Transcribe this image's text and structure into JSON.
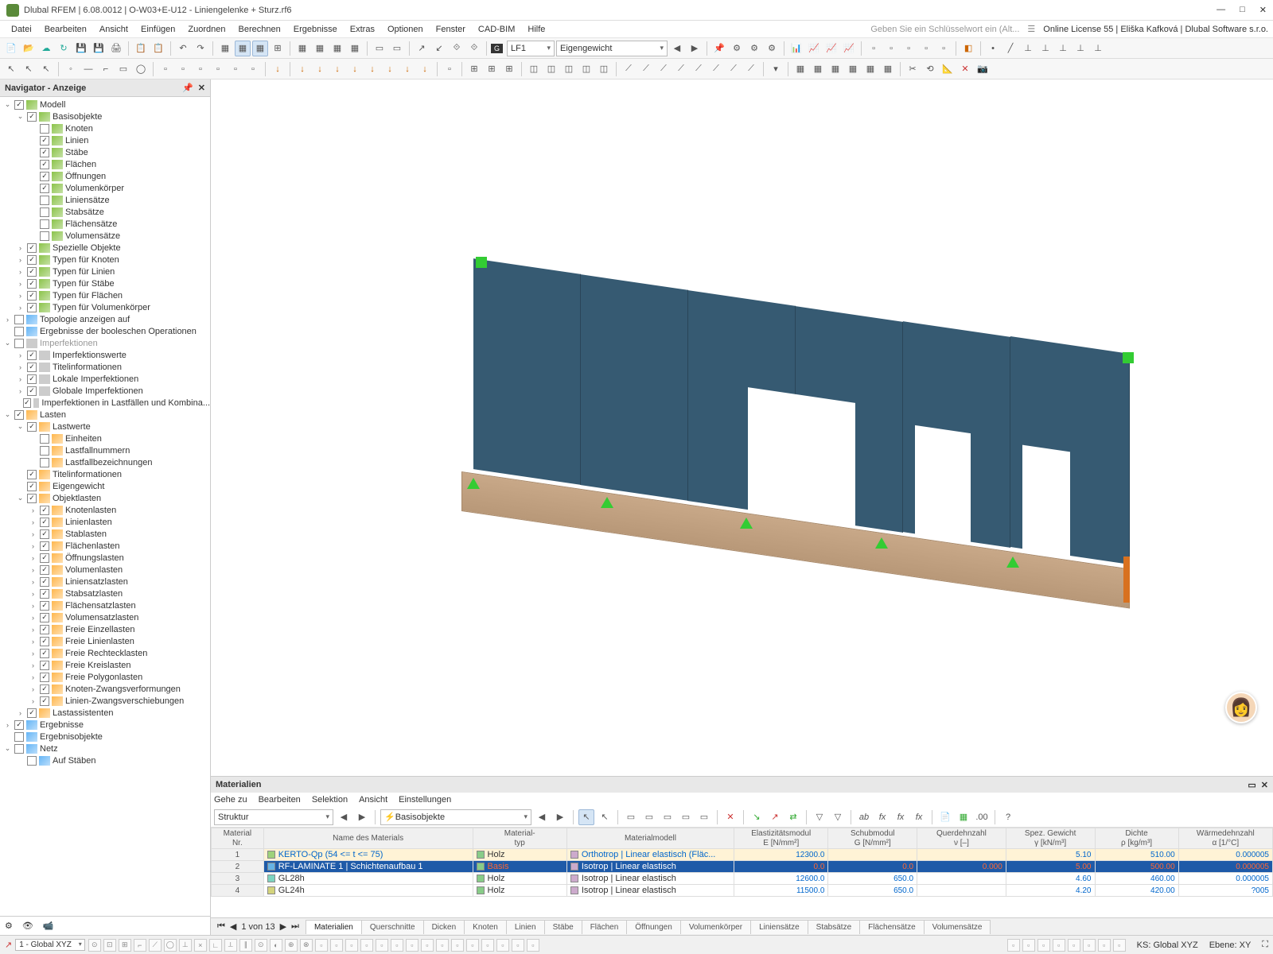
{
  "title": "Dlubal RFEM | 6.08.0012 | O-W03+E-U12 - Liniengelenke + Sturz.rf6",
  "menus": [
    "Datei",
    "Bearbeiten",
    "Ansicht",
    "Einfügen",
    "Zuordnen",
    "Berechnen",
    "Ergebnisse",
    "Extras",
    "Optionen",
    "Fenster",
    "CAD-BIM",
    "Hilfe"
  ],
  "search_placeholder": "Geben Sie ein Schlüsselwort ein (Alt...",
  "license": "Online License 55 | Eliška Kafková | Dlubal Software s.r.o.",
  "lf_code": "LF1",
  "lf_name": "Eigengewicht",
  "navigator": {
    "title": "Navigator - Anzeige",
    "tree": [
      {
        "d": 0,
        "e": "v",
        "c": 1,
        "i": "green",
        "t": "Modell"
      },
      {
        "d": 1,
        "e": "v",
        "c": 1,
        "i": "green",
        "t": "Basisobjekte"
      },
      {
        "d": 2,
        "e": "",
        "c": 0,
        "i": "green",
        "t": "Knoten"
      },
      {
        "d": 2,
        "e": "",
        "c": 1,
        "i": "green",
        "t": "Linien"
      },
      {
        "d": 2,
        "e": "",
        "c": 1,
        "i": "green",
        "t": "Stäbe"
      },
      {
        "d": 2,
        "e": "",
        "c": 1,
        "i": "green",
        "t": "Flächen"
      },
      {
        "d": 2,
        "e": "",
        "c": 1,
        "i": "green",
        "t": "Öffnungen"
      },
      {
        "d": 2,
        "e": "",
        "c": 1,
        "i": "green",
        "t": "Volumenkörper"
      },
      {
        "d": 2,
        "e": "",
        "c": 0,
        "i": "green",
        "t": "Liniensätze"
      },
      {
        "d": 2,
        "e": "",
        "c": 0,
        "i": "green",
        "t": "Stabsätze"
      },
      {
        "d": 2,
        "e": "",
        "c": 0,
        "i": "green",
        "t": "Flächensätze"
      },
      {
        "d": 2,
        "e": "",
        "c": 0,
        "i": "green",
        "t": "Volumensätze"
      },
      {
        "d": 1,
        "e": ">",
        "c": 1,
        "i": "green",
        "t": "Spezielle Objekte"
      },
      {
        "d": 1,
        "e": ">",
        "c": 1,
        "i": "green",
        "t": "Typen für Knoten"
      },
      {
        "d": 1,
        "e": ">",
        "c": 1,
        "i": "green",
        "t": "Typen für Linien"
      },
      {
        "d": 1,
        "e": ">",
        "c": 1,
        "i": "green",
        "t": "Typen für Stäbe"
      },
      {
        "d": 1,
        "e": ">",
        "c": 1,
        "i": "green",
        "t": "Typen für Flächen"
      },
      {
        "d": 1,
        "e": ">",
        "c": 1,
        "i": "green",
        "t": "Typen für Volumenkörper"
      },
      {
        "d": 0,
        "e": ">",
        "c": 0,
        "i": "blue",
        "t": "Topologie anzeigen auf"
      },
      {
        "d": 0,
        "e": "",
        "c": 0,
        "i": "blue",
        "t": "Ergebnisse der booleschen Operationen"
      },
      {
        "d": 0,
        "e": "v",
        "c": 0,
        "i": "gray",
        "t": "Imperfektionen",
        "dim": 1
      },
      {
        "d": 1,
        "e": ">",
        "c": 1,
        "i": "gray",
        "t": "Imperfektionswerte"
      },
      {
        "d": 1,
        "e": ">",
        "c": 1,
        "i": "gray",
        "t": "Titelinformationen"
      },
      {
        "d": 1,
        "e": ">",
        "c": 1,
        "i": "gray",
        "t": "Lokale Imperfektionen"
      },
      {
        "d": 1,
        "e": ">",
        "c": 1,
        "i": "gray",
        "t": "Globale Imperfektionen"
      },
      {
        "d": 1,
        "e": "",
        "c": 1,
        "i": "gray",
        "t": "Imperfektionen in Lastfällen und Kombina..."
      },
      {
        "d": 0,
        "e": "v",
        "c": 1,
        "i": "orange",
        "t": "Lasten"
      },
      {
        "d": 1,
        "e": "v",
        "c": 1,
        "i": "orange",
        "t": "Lastwerte"
      },
      {
        "d": 2,
        "e": "",
        "c": 0,
        "i": "orange",
        "t": "Einheiten"
      },
      {
        "d": 2,
        "e": "",
        "c": 0,
        "i": "orange",
        "t": "Lastfallnummern"
      },
      {
        "d": 2,
        "e": "",
        "c": 0,
        "i": "orange",
        "t": "Lastfallbezeichnungen"
      },
      {
        "d": 1,
        "e": "",
        "c": 1,
        "i": "orange",
        "t": "Titelinformationen"
      },
      {
        "d": 1,
        "e": "",
        "c": 1,
        "i": "orange",
        "t": "Eigengewicht"
      },
      {
        "d": 1,
        "e": "v",
        "c": 1,
        "i": "orange",
        "t": "Objektlasten"
      },
      {
        "d": 2,
        "e": ">",
        "c": 1,
        "i": "orange",
        "t": "Knotenlasten"
      },
      {
        "d": 2,
        "e": ">",
        "c": 1,
        "i": "orange",
        "t": "Linienlasten"
      },
      {
        "d": 2,
        "e": ">",
        "c": 1,
        "i": "orange",
        "t": "Stablasten"
      },
      {
        "d": 2,
        "e": ">",
        "c": 1,
        "i": "orange",
        "t": "Flächenlasten"
      },
      {
        "d": 2,
        "e": ">",
        "c": 1,
        "i": "orange",
        "t": "Öffnungslasten"
      },
      {
        "d": 2,
        "e": ">",
        "c": 1,
        "i": "orange",
        "t": "Volumenlasten"
      },
      {
        "d": 2,
        "e": ">",
        "c": 1,
        "i": "orange",
        "t": "Liniensatzlasten"
      },
      {
        "d": 2,
        "e": ">",
        "c": 1,
        "i": "orange",
        "t": "Stabsatzlasten"
      },
      {
        "d": 2,
        "e": ">",
        "c": 1,
        "i": "orange",
        "t": "Flächensatzlasten"
      },
      {
        "d": 2,
        "e": ">",
        "c": 1,
        "i": "orange",
        "t": "Volumensatzlasten"
      },
      {
        "d": 2,
        "e": ">",
        "c": 1,
        "i": "orange",
        "t": "Freie Einzellasten"
      },
      {
        "d": 2,
        "e": ">",
        "c": 1,
        "i": "orange",
        "t": "Freie Linienlasten"
      },
      {
        "d": 2,
        "e": ">",
        "c": 1,
        "i": "orange",
        "t": "Freie Rechtecklasten"
      },
      {
        "d": 2,
        "e": ">",
        "c": 1,
        "i": "orange",
        "t": "Freie Kreislasten"
      },
      {
        "d": 2,
        "e": ">",
        "c": 1,
        "i": "orange",
        "t": "Freie Polygonlasten"
      },
      {
        "d": 2,
        "e": ">",
        "c": 1,
        "i": "orange",
        "t": "Knoten-Zwangsverformungen"
      },
      {
        "d": 2,
        "e": ">",
        "c": 1,
        "i": "orange",
        "t": "Linien-Zwangsverschiebungen"
      },
      {
        "d": 1,
        "e": ">",
        "c": 1,
        "i": "orange",
        "t": "Lastassistenten"
      },
      {
        "d": 0,
        "e": ">",
        "c": 1,
        "i": "blue",
        "t": "Ergebnisse"
      },
      {
        "d": 0,
        "e": "",
        "c": 0,
        "i": "blue",
        "t": "Ergebnisobjekte"
      },
      {
        "d": 0,
        "e": "v",
        "c": 0,
        "i": "blue",
        "t": "Netz"
      },
      {
        "d": 1,
        "e": "",
        "c": 0,
        "i": "blue",
        "t": "Auf Stäben"
      }
    ]
  },
  "materials": {
    "title": "Materialien",
    "menus": [
      "Gehe zu",
      "Bearbeiten",
      "Selektion",
      "Ansicht",
      "Einstellungen"
    ],
    "combo1": "Struktur",
    "combo2": "Basisobjekte",
    "headers": [
      "Material\nNr.",
      "Name des Materials",
      "Material-\ntyp",
      "Materialmodell",
      "Elastizitätsmodul\nE [N/mm²]",
      "Schubmodul\nG [N/mm²]",
      "Querdehnzahl\nν [–]",
      "Spez. Gewicht\nγ [kN/m³]",
      "Dichte\nρ [kg/m³]",
      "Wärmedehnzahl\nα [1/°C]"
    ],
    "rows": [
      {
        "nr": "1",
        "sw": "#9ed27a",
        "name": "KERTO-Qp (54 <= t <= 75)",
        "typ": "Holz",
        "model": "Orthotrop | Linear elastisch (Fläc...",
        "E": "12300.0",
        "G": "",
        "nu": "",
        "gamma": "5.10",
        "rho": "510.00",
        "alpha": "0.000005",
        "cls": "hot",
        "namecolor": "#0066cc",
        "modelcolor": "#0066cc"
      },
      {
        "nr": "2",
        "sw": "#66b3e6",
        "name": "RF-LAMINATE 1 | Schichtenaufbau 1",
        "typ": "Basis",
        "model": "Isotrop | Linear elastisch",
        "E": "0.0",
        "G": "0.0",
        "nu": "0.000",
        "gamma": "5.00",
        "rho": "500.00",
        "alpha": "0.000005",
        "cls": "sel",
        "namecolor": "#fff",
        "modelcolor": "#fff",
        "typcolor": "#ff6633",
        "redvals": 1
      },
      {
        "nr": "3",
        "sw": "#7dd4c0",
        "name": "GL28h",
        "typ": "Holz",
        "model": "Isotrop | Linear elastisch",
        "E": "12600.0",
        "G": "650.0",
        "nu": "",
        "gamma": "4.60",
        "rho": "460.00",
        "alpha": "0.000005"
      },
      {
        "nr": "4",
        "sw": "#d4d47d",
        "name": "GL24h",
        "typ": "Holz",
        "model": "Isotrop | Linear elastisch",
        "E": "11500.0",
        "G": "650.0",
        "nu": "",
        "gamma": "4.20",
        "rho": "420.00",
        "alpha": "?005"
      }
    ],
    "pager": "1 von 13",
    "tabs": [
      "Materialien",
      "Querschnitte",
      "Dicken",
      "Knoten",
      "Linien",
      "Stäbe",
      "Flächen",
      "Öffnungen",
      "Volumenkörper",
      "Liniensätze",
      "Stabsätze",
      "Flächensätze",
      "Volumensätze"
    ]
  },
  "status": {
    "cs": "1 - Global XYZ",
    "ks": "KS: Global XYZ",
    "ebene": "Ebene: XY"
  }
}
